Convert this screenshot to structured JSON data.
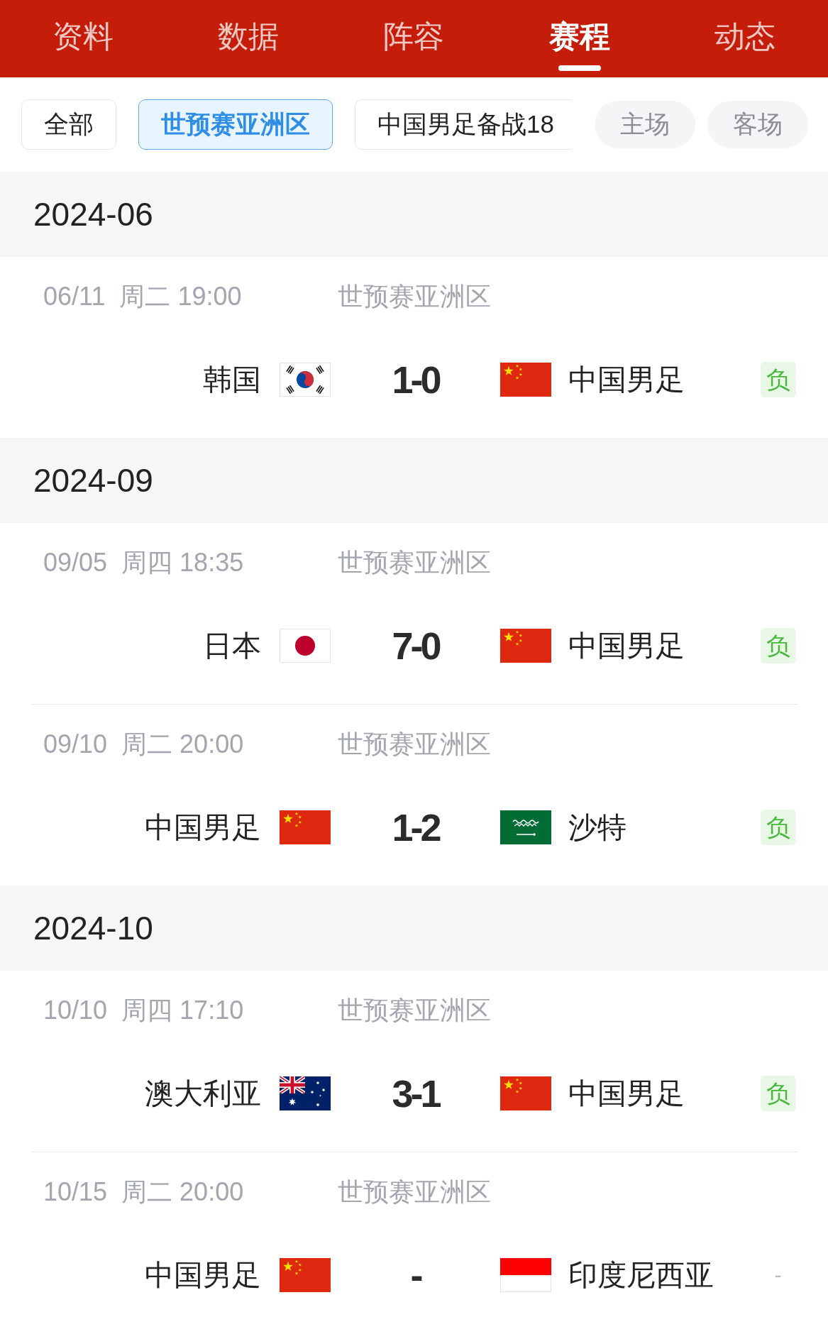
{
  "nav_tabs": [
    {
      "label": "资料",
      "selected": false
    },
    {
      "label": "数据",
      "selected": false
    },
    {
      "label": "阵容",
      "selected": false
    },
    {
      "label": "赛程",
      "selected": true
    },
    {
      "label": "动态",
      "selected": false
    }
  ],
  "filters": {
    "competitions": [
      {
        "label": "全部",
        "selected": false
      },
      {
        "label": "世预赛亚洲区",
        "selected": true
      },
      {
        "label": "中国男足备战18",
        "selected": false
      }
    ],
    "venues": [
      {
        "label": "主场",
        "selected": false
      },
      {
        "label": "客场",
        "selected": false
      }
    ]
  },
  "months": [
    {
      "month": "2024-06",
      "matches": [
        {
          "date": "06/11",
          "time": "周二 19:00",
          "competition": "世预赛亚洲区",
          "home": {
            "name": "韩国",
            "flag": {
              "kind": "korea"
            }
          },
          "score": "1-0",
          "away": {
            "name": "中国男足",
            "flag": {
              "kind": "china"
            }
          },
          "result": {
            "text": "负",
            "kind": "loss"
          }
        }
      ]
    },
    {
      "month": "2024-09",
      "matches": [
        {
          "date": "09/05",
          "time": "周四 18:35",
          "competition": "世预赛亚洲区",
          "home": {
            "name": "日本",
            "flag": {
              "kind": "japan"
            }
          },
          "score": "7-0",
          "away": {
            "name": "中国男足",
            "flag": {
              "kind": "china"
            }
          },
          "result": {
            "text": "负",
            "kind": "loss"
          }
        },
        {
          "date": "09/10",
          "time": "周二 20:00",
          "competition": "世预赛亚洲区",
          "home": {
            "name": "中国男足",
            "flag": {
              "kind": "china"
            }
          },
          "score": "1-2",
          "away": {
            "name": "沙特",
            "flag": {
              "kind": "saudi"
            }
          },
          "result": {
            "text": "负",
            "kind": "loss"
          }
        }
      ]
    },
    {
      "month": "2024-10",
      "matches": [
        {
          "date": "10/10",
          "time": "周四 17:10",
          "competition": "世预赛亚洲区",
          "home": {
            "name": "澳大利亚",
            "flag": {
              "kind": "australia"
            }
          },
          "score": "3-1",
          "away": {
            "name": "中国男足",
            "flag": {
              "kind": "china"
            }
          },
          "result": {
            "text": "负",
            "kind": "loss"
          }
        },
        {
          "date": "10/15",
          "time": "周二 20:00",
          "competition": "世预赛亚洲区",
          "home": {
            "name": "中国男足",
            "flag": {
              "kind": "china"
            }
          },
          "score": "-",
          "away": {
            "name": "印度尼西亚",
            "flag": {
              "kind": "indonesia"
            }
          },
          "result": {
            "text": "-",
            "kind": "pending"
          }
        }
      ]
    }
  ]
}
